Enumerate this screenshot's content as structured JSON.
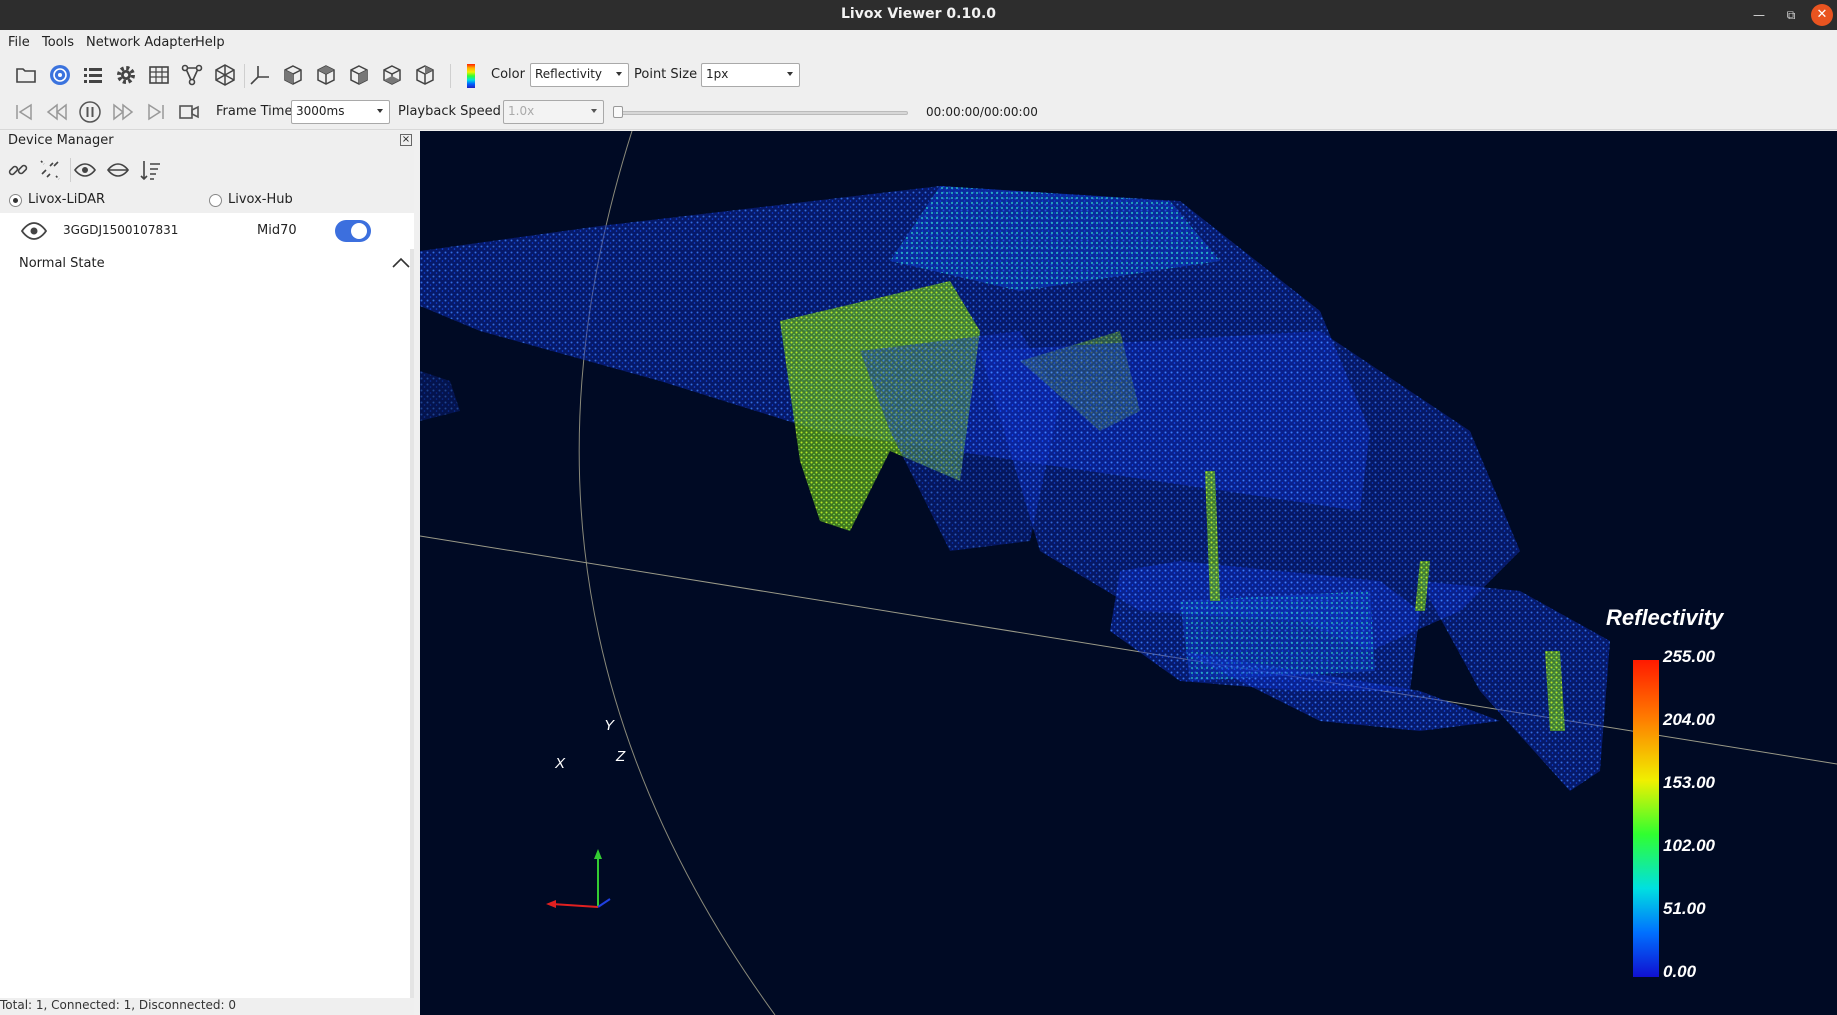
{
  "window": {
    "title": "Livox Viewer 0.10.0",
    "minimize_icon": "minimize-icon",
    "maximize_icon": "maximize-icon",
    "close_icon": "close-icon"
  },
  "menu": {
    "items": [
      "File",
      "Tools",
      "Network Adapter",
      "Help"
    ]
  },
  "toolbar": {
    "buttons": [
      "open-folder-icon",
      "lidar-radar-icon",
      "list-icon",
      "gear-icon",
      "table-icon",
      "graph-nodes-icon",
      "cube-wire-icon",
      "axes-icon",
      "cube-front-icon",
      "cube-side-icon",
      "cube-right-icon",
      "cube-back-icon",
      "cube-top-icon"
    ],
    "color_label": "Color",
    "color_value": "Reflectivity",
    "point_size_label": "Point Size",
    "point_size_value": "1px"
  },
  "playback": {
    "buttons": [
      "skip-start-icon",
      "rewind-icon",
      "pause-icon",
      "fast-forward-icon",
      "skip-end-icon",
      "video-camera-icon"
    ],
    "frame_time_label": "Frame Time",
    "frame_time_value": "3000ms",
    "playback_speed_label": "Playback Speed",
    "playback_speed_value": "1.0x",
    "progress": 0,
    "time_display": "00:00:00/00:00:00"
  },
  "device_manager": {
    "title": "Device Manager",
    "tools": [
      "link-icon",
      "unlink-icon",
      "eye-icon",
      "hide-icon",
      "sort-list-icon"
    ],
    "modes": [
      {
        "label": "Livox-LiDAR",
        "checked": true
      },
      {
        "label": "Livox-Hub",
        "checked": false
      }
    ],
    "devices": [
      {
        "serial": "3GGDJ1500107831",
        "model": "Mid70",
        "enabled": true
      }
    ],
    "state_label": "Normal State",
    "status_bar": "Total: 1, Connected: 1, Disconnected: 0"
  },
  "viewport": {
    "legend_title": "Reflectivity",
    "legend_ticks": [
      "255.00",
      "204.00",
      "153.00",
      "102.00",
      "51.00",
      "0.00"
    ],
    "axis_labels": {
      "x": "X",
      "y": "Y",
      "z": "Z"
    },
    "background": "#000a24"
  }
}
